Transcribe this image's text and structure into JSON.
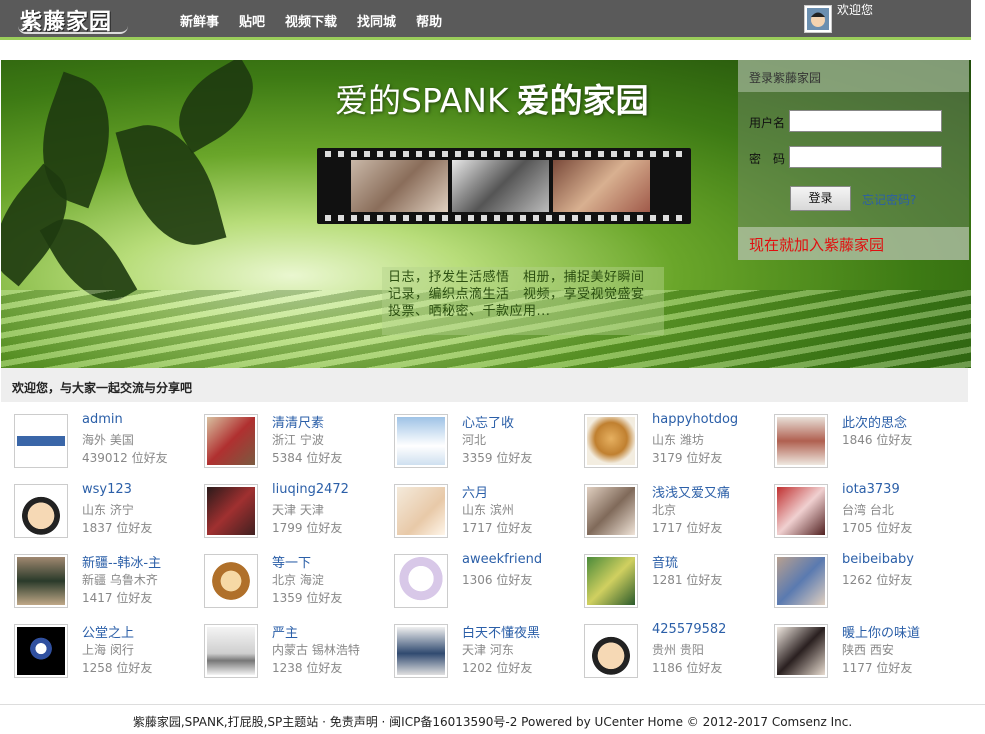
{
  "topbar": {
    "logo_text": "紫藤家园",
    "nav": [
      "新鲜事",
      "贴吧",
      "视频下载",
      "找同城",
      "帮助"
    ],
    "welcome": "欢迎您"
  },
  "banner": {
    "title_main": "爱的SPANK",
    "title_bold": "爱的家园",
    "description": "日志，抒发生活感悟　相册，捕捉美好瞬间　记录，编织点滴生活　视频，享受视觉盛宴　投票、晒秘密、千款应用..."
  },
  "login": {
    "header": "登录紫藤家园",
    "username_label": "用户名",
    "password_label": "密　码",
    "login_button": "登录",
    "forgot": "忘记密码?",
    "join": "现在就加入紫藤家园"
  },
  "section": {
    "title": "欢迎您，与大家一起交流与分享吧"
  },
  "users": [
    {
      "name": "admin",
      "location": "海外 美国",
      "friends": "439012 位好友",
      "avatar": "cartoon-glasses"
    },
    {
      "name": "清清尺素",
      "location": "浙江 宁波",
      "friends": "5384 位好友",
      "avatar": "photo-red"
    },
    {
      "name": "心忘了收",
      "location": "河北",
      "friends": "3359 位好友",
      "avatar": "photo-sky"
    },
    {
      "name": "happyhotdog",
      "location": "山东 潍坊",
      "friends": "3179 位好友",
      "avatar": "photo-dog"
    },
    {
      "name": "此次的思念",
      "location": "",
      "friends": "1846 位好友",
      "avatar": "photo-back"
    },
    {
      "name": "wsy123",
      "location": "山东 济宁",
      "friends": "1837 位好友",
      "avatar": "cartoon-boy"
    },
    {
      "name": "liuqing2472",
      "location": "天津 天津",
      "friends": "1799 位好友",
      "avatar": "photo-dark"
    },
    {
      "name": "六月",
      "location": "山东 滨州",
      "friends": "1717 位好友",
      "avatar": "photo-pale"
    },
    {
      "name": "浅浅又爱又痛",
      "location": "北京",
      "friends": "1717 位好友",
      "avatar": "photo-girl"
    },
    {
      "name": "iota3739",
      "location": "台湾 台北",
      "friends": "1705 位好友",
      "avatar": "photo-collage"
    },
    {
      "name": "新疆--韩冰-主",
      "location": "新疆 乌鲁木齐",
      "friends": "1417 位好友",
      "avatar": "photo-soldier"
    },
    {
      "name": "等一下",
      "location": "北京 海淀",
      "friends": "1359 位好友",
      "avatar": "cartoon-girl"
    },
    {
      "name": "aweekfriend",
      "location": "",
      "friends": "1306 位好友",
      "avatar": "anime-white"
    },
    {
      "name": "音琉",
      "location": "",
      "friends": "1281 位好友",
      "avatar": "photo-flowers"
    },
    {
      "name": "beibeibaby",
      "location": "",
      "friends": "1262 位好友",
      "avatar": "photo-blue"
    },
    {
      "name": "公堂之上",
      "location": "上海 闵行",
      "friends": "1258 位好友",
      "avatar": "photo-moon"
    },
    {
      "name": "严主",
      "location": "内蒙古 锡林浩特",
      "friends": "1238 位好友",
      "avatar": "photo-grey"
    },
    {
      "name": "白天不懂夜黑",
      "location": "天津 河东",
      "friends": "1202 位好友",
      "avatar": "photo-man"
    },
    {
      "name": "425579582",
      "location": "贵州 贵阳",
      "friends": "1186 位好友",
      "avatar": "cartoon-boy"
    },
    {
      "name": "暖上你の味道",
      "location": "陕西 西安",
      "friends": "1177 位好友",
      "avatar": "photo-woman"
    }
  ],
  "footer": {
    "text": "紫藤家园,SPANK,打屁股,SP主题站 · 免责声明 · 闽ICP备16013590号-2 Powered by UCenter Home © 2012-2017 Comsenz Inc."
  },
  "colors": {
    "topbar": "#5a5a5a",
    "accent_green": "#9acd5a",
    "link_blue": "#2b5fa8",
    "join_red": "#e01010"
  }
}
